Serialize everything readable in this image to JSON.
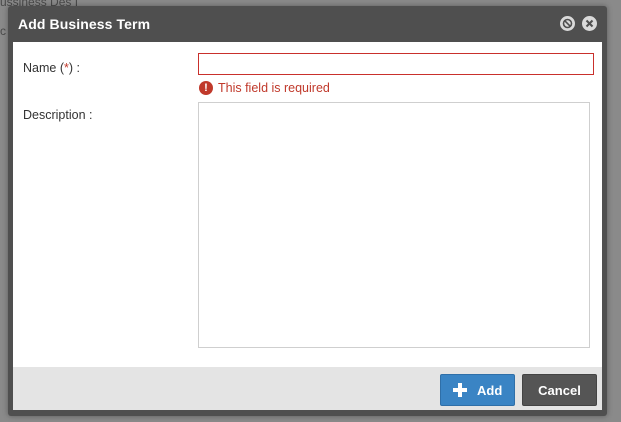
{
  "background": {
    "line1": "ussiness Des I",
    "line2": "c"
  },
  "dialog": {
    "title": "Add Business Term",
    "minimize_icon": "minimize-circle-icon",
    "close_icon": "close-circle-icon"
  },
  "form": {
    "name_label_prefix": "Name (",
    "name_label_required": "*",
    "name_label_suffix": ") :",
    "name_value": "",
    "name_placeholder": "",
    "name_error": "This field is required",
    "error_icon_glyph": "!",
    "description_label": "Description :",
    "description_value": "",
    "description_placeholder": ""
  },
  "footer": {
    "add_label": "Add",
    "cancel_label": "Cancel"
  },
  "colors": {
    "title_bar": "#4f4f4f",
    "error": "#c0392b",
    "add_button": "#3a84c4",
    "cancel_button": "#555555"
  }
}
